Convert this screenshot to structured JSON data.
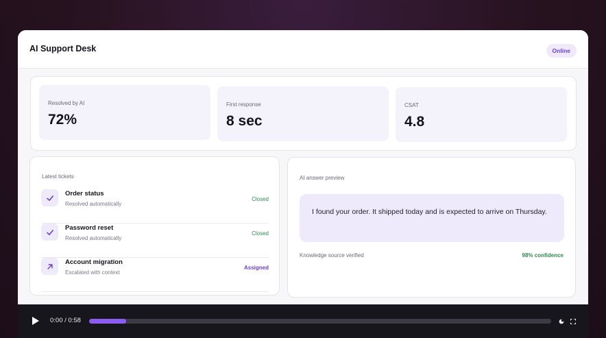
{
  "header": {
    "title": "AI Support Desk",
    "status": "Online"
  },
  "stats": [
    {
      "label": "Resolved by AI",
      "value": "72%"
    },
    {
      "label": "First response",
      "value": "8 sec"
    },
    {
      "label": "CSAT",
      "value": "4.8"
    }
  ],
  "tickets": {
    "title": "Latest tickets",
    "items": [
      {
        "title": "Order status",
        "subtitle": "Resolved automatically",
        "status": "Closed",
        "icon": "check-icon"
      },
      {
        "title": "Password reset",
        "subtitle": "Resolved automatically",
        "status": "Closed",
        "icon": "check-icon"
      },
      {
        "title": "Account migration",
        "subtitle": "Escalated with context",
        "status": "Assigned",
        "icon": "arrow-up-right-icon"
      }
    ]
  },
  "preview": {
    "title": "AI answer preview",
    "message": "I found your order. It shipped today and is expected to arrive on Thursday.",
    "source": "Knowledge source verified",
    "confidence": "98% confidence"
  },
  "player": {
    "time": "0:00 / 0:58",
    "progress": 0.08
  },
  "colors": {
    "accent": "#6b3fd6",
    "success": "#2f8a50",
    "player_fill": "#8a5cf0"
  }
}
